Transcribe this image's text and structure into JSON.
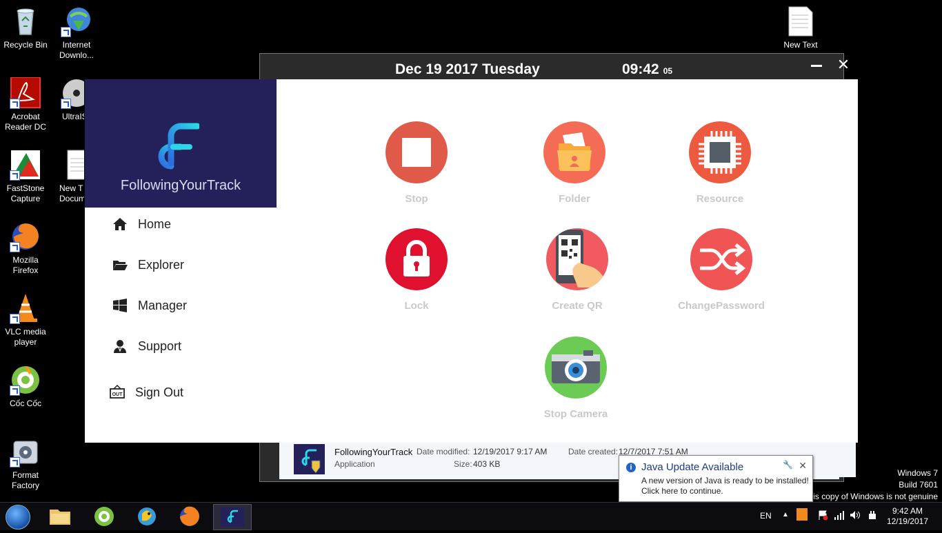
{
  "desktop": {
    "icons": [
      {
        "label": "Recycle Bin"
      },
      {
        "label": "Internet Downlo..."
      },
      {
        "label": "Acrobat Reader DC"
      },
      {
        "label": "UltraIS"
      },
      {
        "label": "FastStone Capture"
      },
      {
        "label": "New T Docum"
      },
      {
        "label": "Mozilla Firefox"
      },
      {
        "label": "VLC media player"
      },
      {
        "label": "Cốc Cốc"
      },
      {
        "label": "Format Factory"
      },
      {
        "label": "New Text"
      }
    ]
  },
  "topbar": {
    "date": "Dec 19 2017 Tuesday",
    "time": "09:42",
    "seconds": "05"
  },
  "sidebar": {
    "brand": "FollowingYourTrack",
    "items": [
      {
        "label": "Home",
        "icon": "home-icon"
      },
      {
        "label": "Explorer",
        "icon": "folder-open-icon"
      },
      {
        "label": "Manager",
        "icon": "windows-icon"
      },
      {
        "label": "Support",
        "icon": "support-person-icon"
      },
      {
        "label": "Sign Out",
        "icon": "exit-icon"
      }
    ]
  },
  "main": {
    "tiles": [
      {
        "label": "Stop",
        "color": "#e05a4a"
      },
      {
        "label": "Folder",
        "color": "#f46c55"
      },
      {
        "label": "Resource",
        "color": "#ee5a3f"
      },
      {
        "label": "Lock",
        "color": "#e0102f"
      },
      {
        "label": "Create QR",
        "color": "#f25a62"
      },
      {
        "label": "ChangePassword",
        "color": "#f05455"
      },
      {
        "label": "Stop Camera",
        "color": "#6ccb54"
      }
    ]
  },
  "fileinfo": {
    "name": "FollowingYourTrack",
    "type": "Application",
    "modified_label": "Date modified:",
    "modified": "12/19/2017 9:17 AM",
    "size_label": "Size:",
    "size": "403 KB",
    "created_label": "Date created:",
    "created": "12/7/2017 7:51 AM"
  },
  "balloon": {
    "title": "Java Update Available",
    "line1": "A new version of Java is ready to be installed!",
    "line2": "Click here to continue."
  },
  "watermark": {
    "line1": "Windows 7",
    "line2": "Build 7601",
    "line3": "is copy of Windows is not genuine"
  },
  "taskbar": {
    "lang": "EN",
    "clock_time": "9:42 AM",
    "clock_date": "12/19/2017"
  }
}
